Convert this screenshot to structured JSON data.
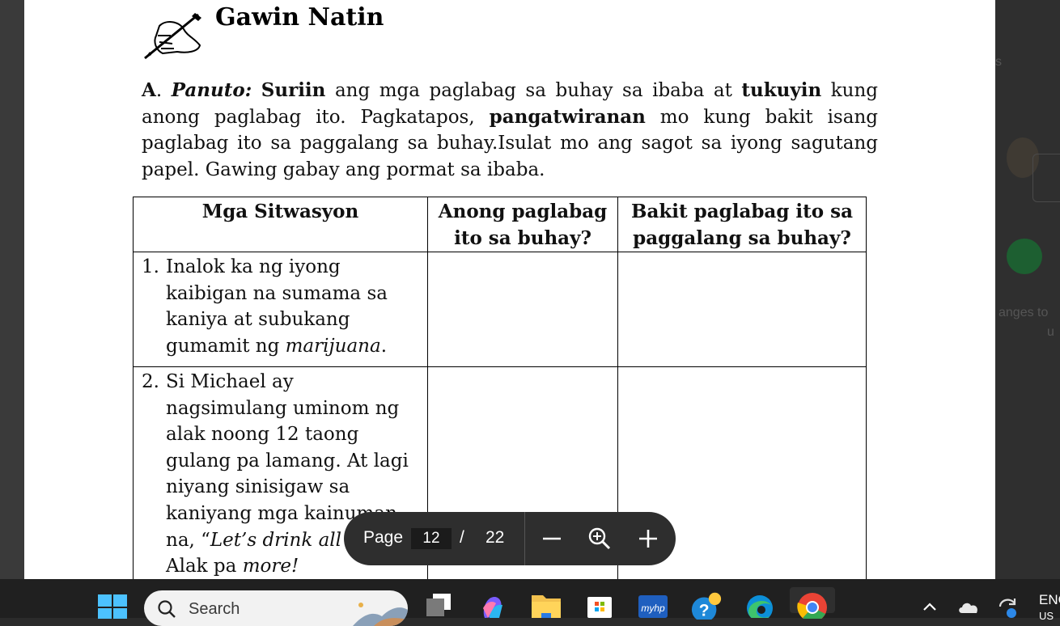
{
  "document": {
    "heading": "Gawin Natin",
    "instructions": {
      "label": "A",
      "dot": ".",
      "panuto": "Panuto:",
      "suriin": "Suriin",
      "text1": " ang mga paglabag sa buhay sa ibaba at ",
      "tukuyin": "tukuyin",
      "text2": " kung anong paglabag ito. Pagkatapos, ",
      "pangatwiranan": "pangatwiranan",
      "text3": " mo kung bakit isang paglabag ito sa paggalang sa buhay.Isulat mo ang sagot sa iyong sagutang papel. Gawing gabay ang pormat sa ibaba."
    },
    "table": {
      "headers": [
        "Mga Sitwasyon",
        "Anong paglabag ito sa buhay?",
        "Bakit paglabag ito sa paggalang sa buhay?"
      ],
      "rows": [
        {
          "number": "1.",
          "before": "Inalok ka ng iyong kaibigan na sumama sa kaniya at subukang gumamit ng ",
          "emphasis": "marijuana",
          "after": "."
        },
        {
          "number": "2.",
          "before": "Si Michael ay nagsimulang uminom ng alak noong 12 taong gulang pa lamang. At lagi niyang sinisigaw sa kaniyang mga kainuman na, “",
          "emphasis": "Let’s drink all day!",
          "after": " Alak pa ",
          "emphasis2": "more!"
        }
      ]
    }
  },
  "viewer": {
    "page_label": "Page",
    "current_page": "12",
    "separator": "/",
    "total_pages": "22"
  },
  "background_window": {
    "partial_text_1": "s",
    "partial_text_2": "anges to",
    "partial_text_3": "u"
  },
  "taskbar": {
    "search_placeholder": "Search",
    "language": "ENG",
    "region": "US",
    "apps": [
      "file-explorer",
      "copilot",
      "folder",
      "store",
      "myhp",
      "help",
      "edge",
      "chrome"
    ]
  }
}
